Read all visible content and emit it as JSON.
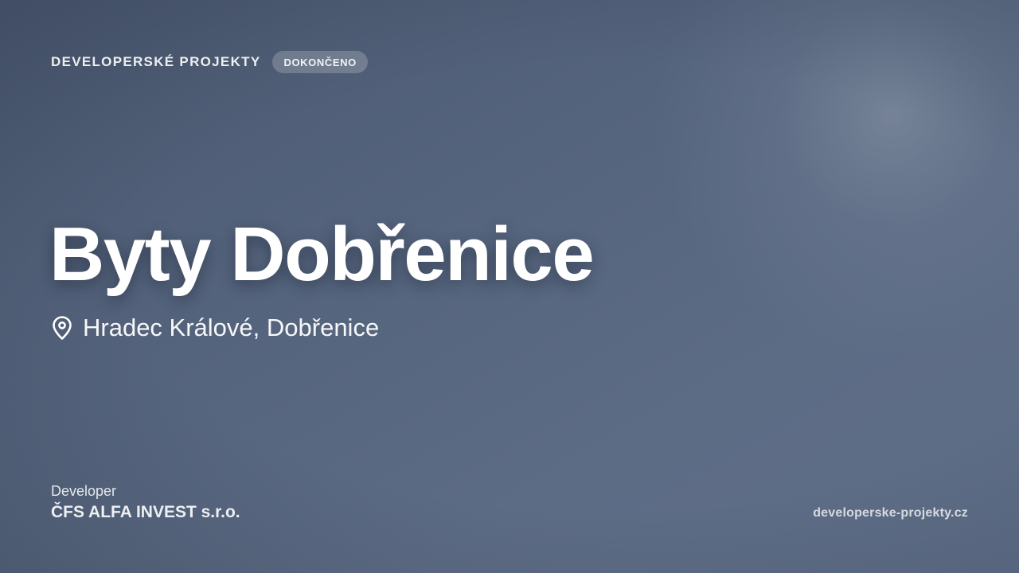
{
  "header": {
    "brand": "DEVELOPERSKÉ PROJEKTY",
    "status_badge": "DOKONČENO"
  },
  "project": {
    "title": "Byty Dobřenice",
    "location": "Hradec Králové, Dobřenice",
    "location_icon": "map-pin-icon"
  },
  "developer": {
    "label": "Developer",
    "name": "ČFS ALFA INVEST s.r.o."
  },
  "footer": {
    "website": "developerske-projekty.cz"
  },
  "colors": {
    "background": "#566580",
    "text": "#ffffff",
    "badge_background": "rgba(255,255,255,0.2)"
  }
}
